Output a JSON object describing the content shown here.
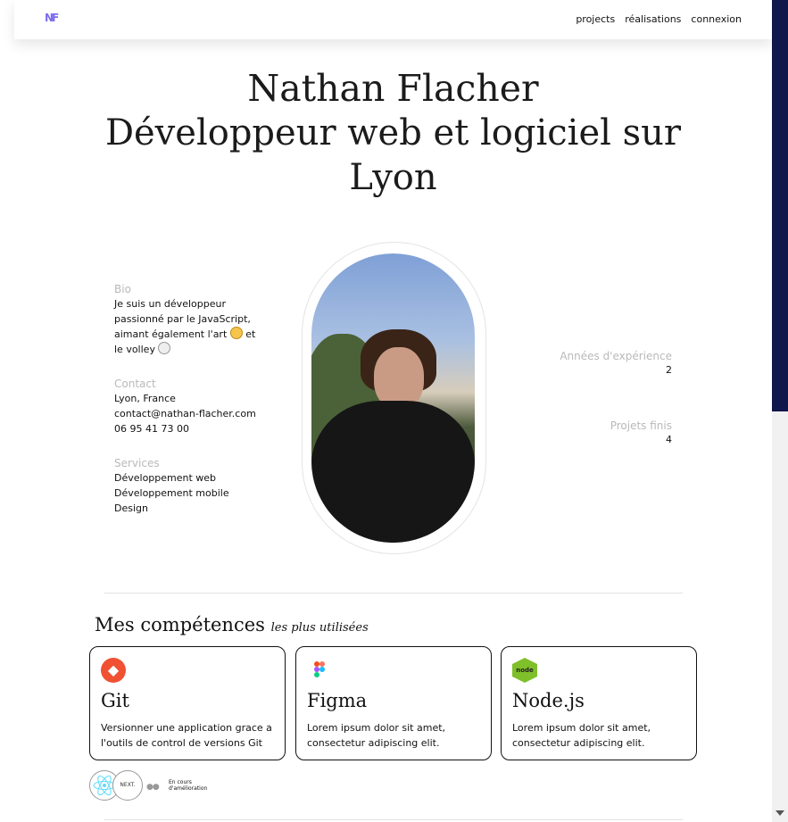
{
  "header": {
    "logo": "NF",
    "nav": [
      "projects",
      "réalisations",
      "connexion"
    ]
  },
  "hero": {
    "lines": [
      "Nathan Flacher",
      "Développeur web et logiciel sur",
      "Lyon"
    ]
  },
  "bio": {
    "label": "Bio",
    "lines": [
      "Je suis un développeur",
      "passionné par le JavaScript,",
      "aimant également l'art",
      "et",
      "le volley"
    ]
  },
  "contact": {
    "label": "Contact",
    "lines": [
      "Lyon, France",
      "contact@nathan-flacher.com",
      "06 95 41 73 00"
    ]
  },
  "services": {
    "label": "Services",
    "lines": [
      "Développement web",
      "Développement mobile",
      "Design"
    ]
  },
  "stats": [
    {
      "label": "Années d'expérience",
      "value": "2"
    },
    {
      "label": "Projets finis",
      "value": "4"
    }
  ],
  "skills": {
    "title": "Mes compétences",
    "subtitle": "les plus utilisées",
    "cards": [
      {
        "icon": "git-icon",
        "name": "Git",
        "desc": "Versionner une application grace a l'outils de control de versions Git",
        "color": "#f05133"
      },
      {
        "icon": "figma-icon",
        "name": "Figma",
        "desc": "Lorem ipsum dolor sit amet, consectetur adipiscing elit."
      },
      {
        "icon": "nodejs-icon",
        "name": "Node.js",
        "desc": "Lorem ipsum dolor sit amet, consectetur adipiscing elit.",
        "color": "#7fbf2a"
      }
    ],
    "wip": {
      "next_badge": "NEXT.",
      "dots": "●●",
      "label_lines": [
        "En cours",
        "d'amélioration"
      ]
    }
  },
  "colors": {
    "accent": "#7b6cf0",
    "scroll_thumb": "#10174a"
  }
}
